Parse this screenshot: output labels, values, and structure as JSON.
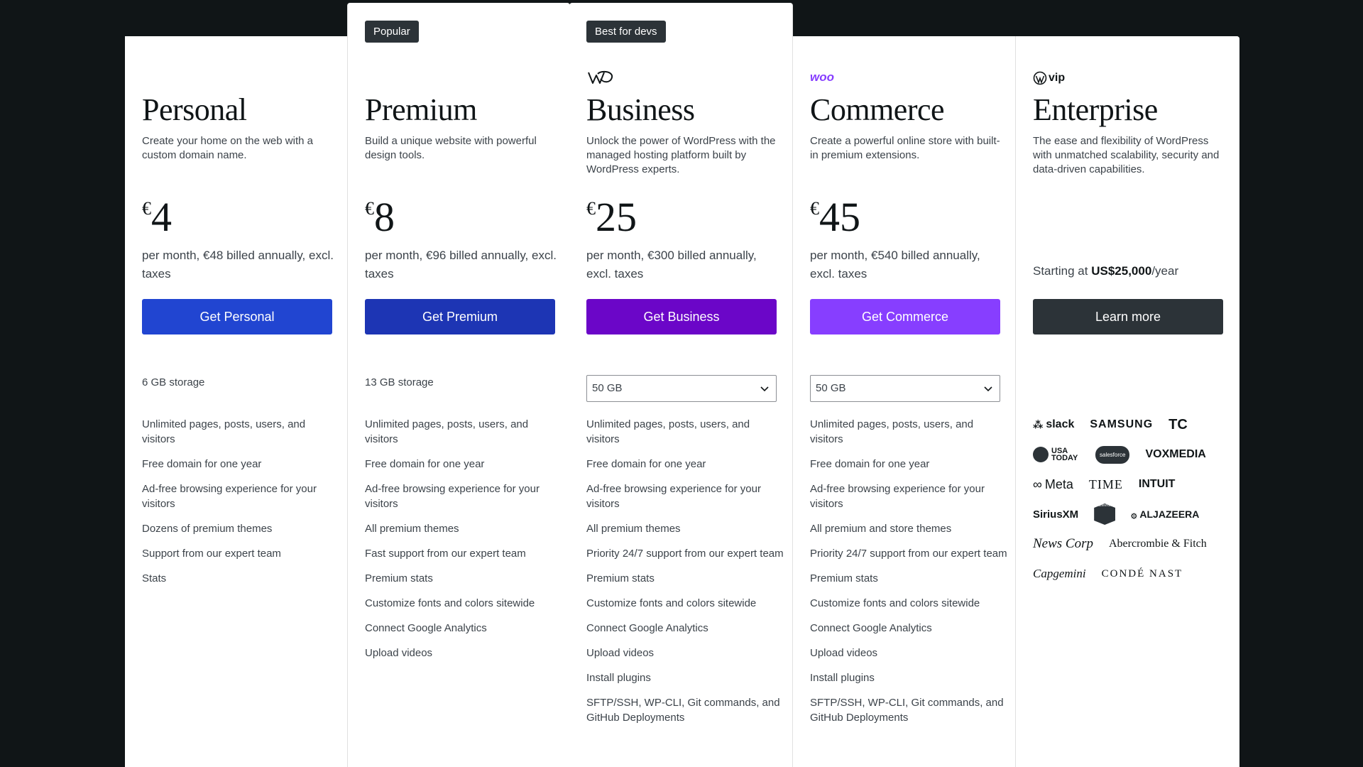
{
  "colors": {
    "personal": "#2145d1",
    "premium": "#1d35b4",
    "business": "#6b06c8",
    "commerce": "#873eff",
    "enterprise": "#2c3338",
    "woo": "#873eff"
  },
  "plans": [
    {
      "name": "Personal",
      "description": "Create your home on the web with a custom domain name.",
      "currency": "€",
      "price": "4",
      "billing": "per month, €48 billed annually, excl. taxes",
      "cta": "Get Personal",
      "storage": "6 GB storage",
      "features": [
        "Unlimited pages, posts, users, and visitors",
        "Free domain for one year",
        "Ad-free browsing experience for your visitors",
        "Dozens of premium themes",
        "Support from our expert team",
        "Stats"
      ]
    },
    {
      "badge": "Popular",
      "name": "Premium",
      "description": "Build a unique website with powerful design tools.",
      "currency": "€",
      "price": "8",
      "billing": "per month, €96 billed annually, excl. taxes",
      "cta": "Get Premium",
      "storage": "13 GB storage",
      "features": [
        "Unlimited pages, posts, users, and visitors",
        "Free domain for one year",
        "Ad-free browsing experience for your visitors",
        "All premium themes",
        "Fast support from our expert team",
        "Premium stats",
        "Customize fonts and colors sitewide",
        "Connect Google Analytics",
        "Upload videos"
      ]
    },
    {
      "badge": "Best for devs",
      "logo": "wp-cloud-logo",
      "name": "Business",
      "description": "Unlock the power of WordPress with the managed hosting platform built by WordPress experts.",
      "currency": "€",
      "price": "25",
      "billing": "per month, €300 billed annually, excl. taxes",
      "cta": "Get Business",
      "storage": "50 GB",
      "features": [
        "Unlimited pages, posts, users, and visitors",
        "Free domain for one year",
        "Ad-free browsing experience for your visitors",
        "All premium themes",
        "Priority 24/7 support from our expert team",
        "Premium stats",
        "Customize fonts and colors sitewide",
        "Connect Google Analytics",
        "Upload videos",
        "Install plugins",
        "SFTP/SSH, WP-CLI, Git commands, and GitHub Deployments"
      ]
    },
    {
      "logo_text": "woo",
      "name": "Commerce",
      "description": "Create a powerful online store with built-in premium extensions.",
      "currency": "€",
      "price": "45",
      "billing": "per month, €540 billed annually, excl. taxes",
      "cta": "Get Commerce",
      "storage": "50 GB",
      "features": [
        "Unlimited pages, posts, users, and visitors",
        "Free domain for one year",
        "Ad-free browsing experience for your visitors",
        "All premium and store themes",
        "Priority 24/7 support from our expert team",
        "Premium stats",
        "Customize fonts and colors sitewide",
        "Connect Google Analytics",
        "Upload videos",
        "Install plugins",
        "SFTP/SSH, WP-CLI, Git commands, and GitHub Deployments"
      ]
    },
    {
      "logo_text": "vip",
      "name": "Enterprise",
      "description": "The ease and flexibility of WordPress with unmatched scalability, security and data-driven capabilities.",
      "starting_prefix": "Starting at",
      "starting_price": "US$25,000",
      "starting_suffix": "/year",
      "cta": "Learn more",
      "logos": [
        [
          "slack",
          "SAMSUNG",
          "TC"
        ],
        [
          "USA TODAY",
          "salesforce",
          "VOXMEDIA"
        ],
        [
          "Meta",
          "TIME",
          "INTUIT"
        ],
        [
          "SiriusXM",
          "Chevron",
          "ALJAZEERA"
        ],
        [
          "News Corp",
          "Abercrombie & Fitch"
        ],
        [
          "Capgemini",
          "CONDÉ NAST"
        ]
      ]
    }
  ]
}
